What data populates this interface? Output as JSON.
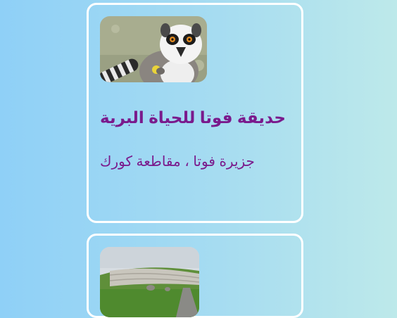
{
  "cards": [
    {
      "title": "حديقة فوتا للحياة البرية",
      "location": "جزيرة فوتا ، مقاطعة كورك",
      "image_subject": "lemur-photo"
    },
    {
      "image_subject": "stone-mound-landscape-photo"
    }
  ],
  "colors": {
    "text": "#7a1a8c",
    "card_border": "#ffffff",
    "background_left": "#8fd0f7",
    "background_right": "#bde9ea"
  }
}
